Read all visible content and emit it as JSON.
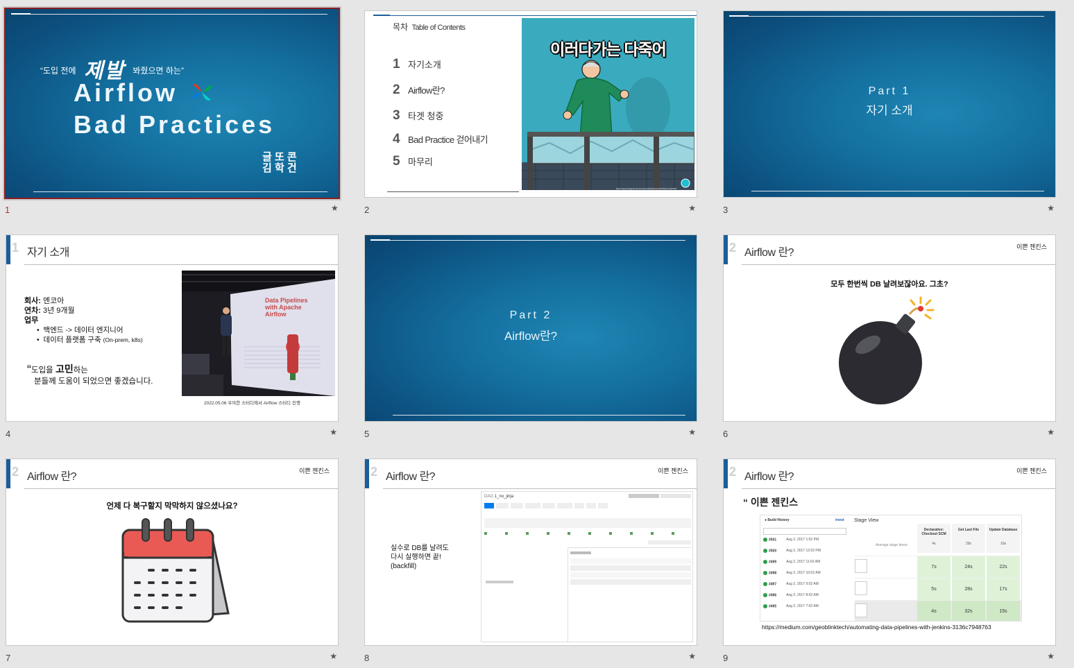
{
  "slides": [
    {
      "number": "1",
      "star": "★",
      "quote_open": "“도입 전에",
      "quote_emph": "제발",
      "quote_close": "봐줬으면 하는”",
      "title_line1": "Airflow",
      "title_line2": "Bad Practices",
      "author1": "글 또 콘",
      "author2": "김 학 건",
      "logo_icon": "airflow-pinwheel-icon"
    },
    {
      "number": "2",
      "star": "★",
      "toc_label": "목차",
      "toc_label_en": "Table of Contents",
      "items": [
        {
          "num": "1",
          "text": "자기소개"
        },
        {
          "num": "2",
          "text": "Airflow란?"
        },
        {
          "num": "3",
          "text": "타겟 청중"
        },
        {
          "num": "4",
          "text": "Bad Practice 걷어내기"
        },
        {
          "num": "5",
          "text": "마무리"
        }
      ],
      "meme_caption": "이러다가는 다죽어",
      "meme_source": "https://www.sisajournal.com/news/articleView.html?idxno=227433"
    },
    {
      "number": "3",
      "star": "★",
      "part": "Part 1",
      "subtitle": "자기 소개"
    },
    {
      "number": "4",
      "star": "★",
      "header_num": "1",
      "header_title": "자기 소개",
      "company_label": "회사:",
      "company_value": " 엔코아",
      "years_label": "연차:",
      "years_value": " 3년 9개월",
      "work_label": "업무",
      "bullets": [
        "백엔드 -> 데이터 엔지니어",
        "데이터 플랫폼 구축"
      ],
      "bullet2_note": "(On-prem, k8s)",
      "quote_mark": "“",
      "quote_pre": "도입을 ",
      "quote_emph": "고민",
      "quote_post": "하는",
      "quote_line2": "분들께 도움이 되었으면 좋겠습니다.",
      "photo_slide_title": "Data Pipelines with Apache Airflow",
      "photo_caption": "2022.05.06 우아한 스터디에서 Airflow 스터디 진행"
    },
    {
      "number": "5",
      "star": "★",
      "part": "Part 2",
      "subtitle": "Airflow란?"
    },
    {
      "number": "6",
      "star": "★",
      "header_num": "2",
      "header_title": "Airflow 란?",
      "tag": "이쁜 젠킨스",
      "text": "모두 한번씩 DB 날려보잖아요. 그초?",
      "icon": "bomb-icon"
    },
    {
      "number": "7",
      "star": "★",
      "header_num": "2",
      "header_title": "Airflow 란?",
      "tag": "이쁜 젠킨스",
      "text": "언제 다 복구할지 막막하지 않으셨나요?",
      "icon": "calendar-icon"
    },
    {
      "number": "8",
      "star": "★",
      "header_num": "2",
      "header_title": "Airflow 란?",
      "tag": "이쁜 젠킨스",
      "text_line1": "실수로 DB를 날려도",
      "text_line2": "다시 실행하면 끝!",
      "text_line3": "(backfill)",
      "dag_name": "1_no_jinja",
      "dag_label": "DAG"
    },
    {
      "number": "9",
      "star": "★",
      "header_num": "2",
      "header_title": "Airflow 란?",
      "tag": "이쁜 젠킨스",
      "quote": "“ 이쁜 젠킨스",
      "build_history": "Build History",
      "trend": "trend",
      "stage_view": "Stage View",
      "cols": [
        "Declarative: Checkout SCM",
        "Get Last File",
        "Update Database"
      ],
      "avg_label": "Average stage times:",
      "avgs": [
        "4s",
        "29s",
        "10s"
      ],
      "builds": [
        {
          "id": "#501",
          "date": "Aug 2, 2017 1:02 PM"
        },
        {
          "id": "#500",
          "date": "Aug 2, 2017 12:02 PM"
        },
        {
          "id": "#499",
          "date": "Aug 2, 2017 11:02 AM"
        },
        {
          "id": "#498",
          "date": "Aug 2, 2017 10:02 AM"
        },
        {
          "id": "#497",
          "date": "Aug 2, 2017 9:02 AM"
        },
        {
          "id": "#496",
          "date": "Aug 2, 2017 8:02 AM"
        },
        {
          "id": "#495",
          "date": "Aug 2, 2017 7:02 AM"
        }
      ],
      "rows": [
        [
          "7s",
          "24s",
          "22s"
        ],
        [
          "5s",
          "28s",
          "17s"
        ],
        [
          "4s",
          "32s",
          "15s"
        ]
      ],
      "url": "https://medium.com/geoblinktech/automating-data-pipelines-with-jenkins-3136c7948763"
    }
  ]
}
